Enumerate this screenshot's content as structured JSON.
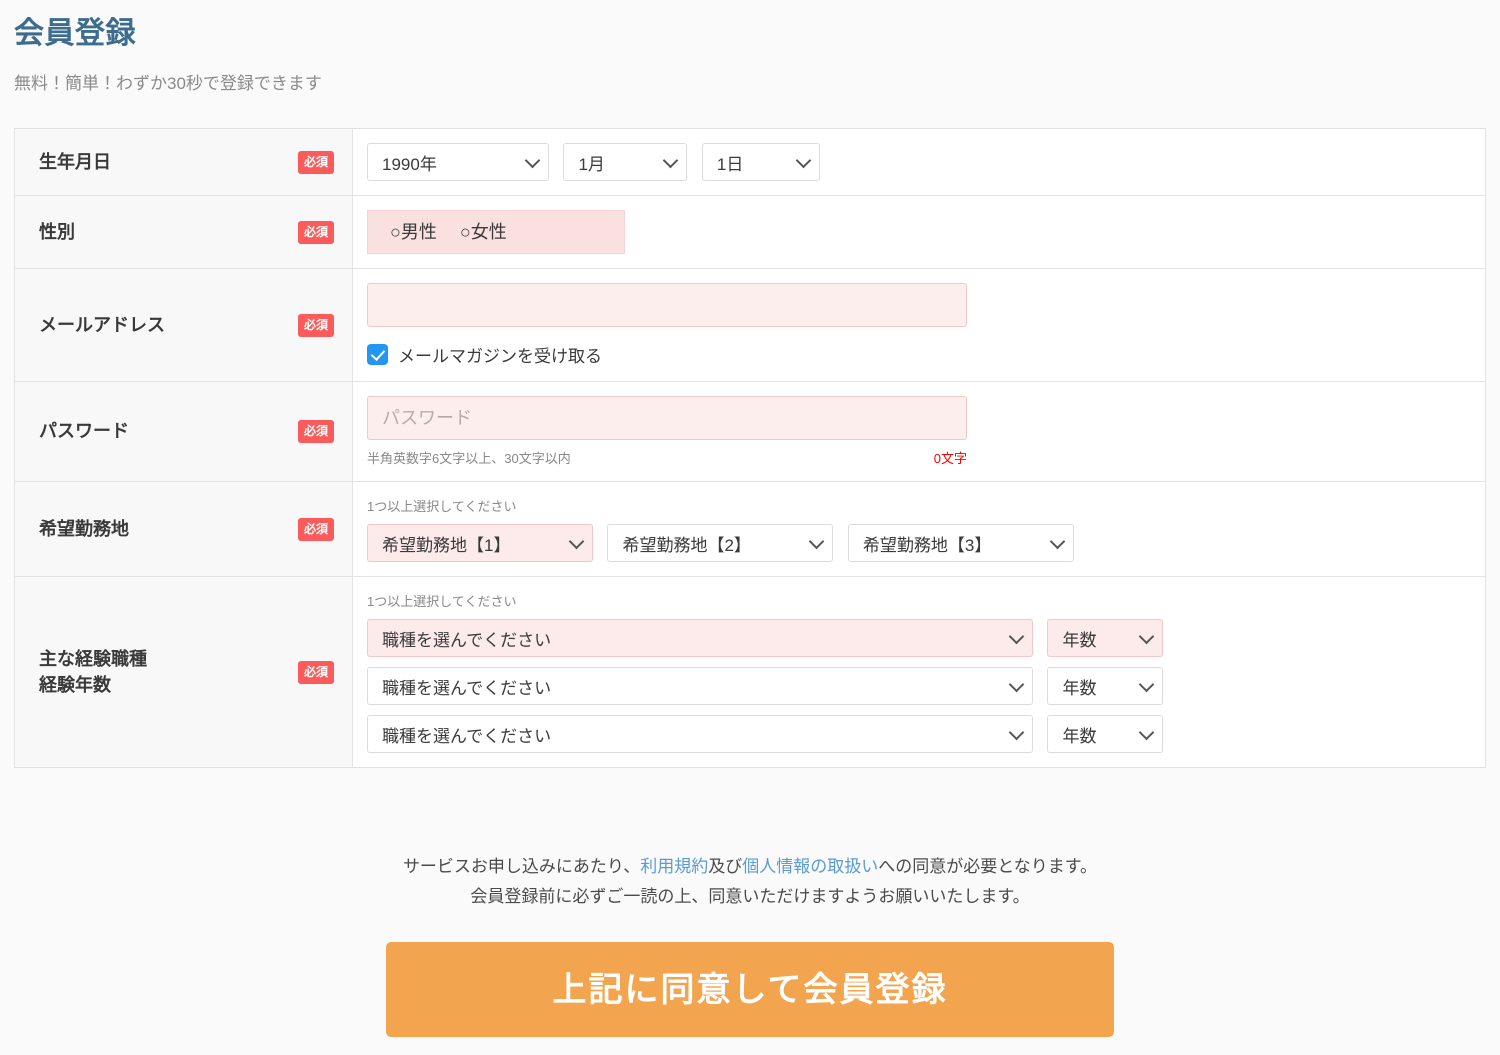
{
  "header": {
    "title": "会員登録",
    "subtitle": "無料！簡単！わずか30秒で登録できます"
  },
  "common": {
    "required_badge": "必須",
    "select_one_or_more": "1つ以上選択してください"
  },
  "rows": {
    "birthdate": {
      "label": "生年月日",
      "year": "1990年",
      "month": "1月",
      "day": "1日"
    },
    "gender": {
      "label": "性別",
      "male": "○男性",
      "female": "○女性"
    },
    "email": {
      "label": "メールアドレス",
      "value": "",
      "placeholder": "",
      "newsletter_label": "メールマガジンを受け取る",
      "newsletter_checked": true
    },
    "password": {
      "label": "パスワード",
      "placeholder": "パスワード",
      "hint": "半角英数字6文字以上、30文字以内",
      "counter": "0文字"
    },
    "work_location": {
      "label": "希望勤務地",
      "hint": "1つ以上選択してください",
      "select1": "希望勤務地【1】",
      "select2": "希望勤務地【2】",
      "select3": "希望勤務地【3】"
    },
    "experience": {
      "label": "主な経験職種\n経験年数",
      "hint": "1つ以上選択してください",
      "job1": "職種を選んでください",
      "years1": "年数",
      "job2": "職種を選んでください",
      "years2": "年数",
      "job3": "職種を選んでください",
      "years3": "年数"
    }
  },
  "footer": {
    "terms_line1_prefix": "サービスお申し込みにあたり、",
    "terms_link1": "利用規約",
    "terms_mid": "及び",
    "terms_link2": "個人情報の取扱い",
    "terms_line1_suffix": "への同意が必要となります。",
    "terms_line2": "会員登録前に必ずご一読の上、同意いただけますようお願いいたします。",
    "submit_label": "上記に同意して会員登録"
  },
  "colors": {
    "title": "#3d6c8e",
    "required_badge": "#fa5c5c",
    "submit": "#f2a44f",
    "link": "#5b9bd5",
    "checkbox": "#2196f3",
    "counter": "#ff0000",
    "field_highlight": "#fdeeee"
  }
}
